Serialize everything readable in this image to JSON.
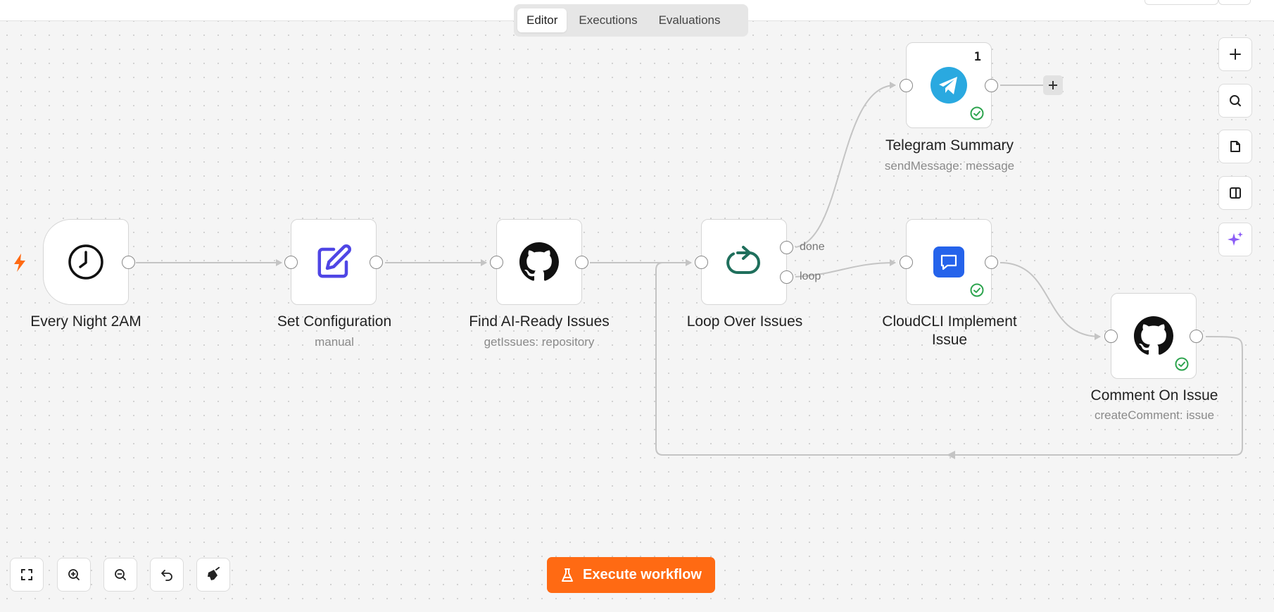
{
  "tabs": [
    {
      "label": "Editor",
      "active": true
    },
    {
      "label": "Executions",
      "active": false
    },
    {
      "label": "Evaluations",
      "active": false
    }
  ],
  "nodes": {
    "every_night": {
      "title": "Every Night 2AM",
      "icon": "clock-icon"
    },
    "set_config": {
      "title": "Set Configuration",
      "subtitle": "manual",
      "icon": "edit-icon"
    },
    "find_issues": {
      "title": "Find AI-Ready Issues",
      "subtitle": "getIssues: repository",
      "icon": "github-icon"
    },
    "loop": {
      "title": "Loop Over Issues",
      "icon": "loop-icon",
      "outputs": {
        "done": "done",
        "loop": "loop"
      }
    },
    "telegram": {
      "title": "Telegram Summary",
      "subtitle": "sendMessage: message",
      "icon": "telegram-icon",
      "badge": "1",
      "status": "success"
    },
    "cloudcli": {
      "title_line1": "CloudCLI Implement",
      "title_line2": "Issue",
      "icon": "chat-icon",
      "status": "success"
    },
    "comment": {
      "title": "Comment On Issue",
      "subtitle": "createComment: issue",
      "icon": "github-icon",
      "status": "success"
    }
  },
  "execute_button": {
    "label": "Execute workflow",
    "icon": "flask-icon"
  },
  "colors": {
    "accent": "#ff6a13",
    "success": "#2da44e",
    "telegram": "#2aa9e0",
    "chat": "#2563eb",
    "loop": "#1f6f5c",
    "edit": "#4f46e5",
    "ai": "#8b5cf6"
  },
  "side_toolbar": [
    "plus-icon",
    "search-icon",
    "sticky-note-icon",
    "panel-icon",
    "sparkle-icon"
  ],
  "bottom_toolbar": [
    "fit-view-icon",
    "zoom-in-icon",
    "zoom-out-icon",
    "undo-icon",
    "clear-icon"
  ]
}
